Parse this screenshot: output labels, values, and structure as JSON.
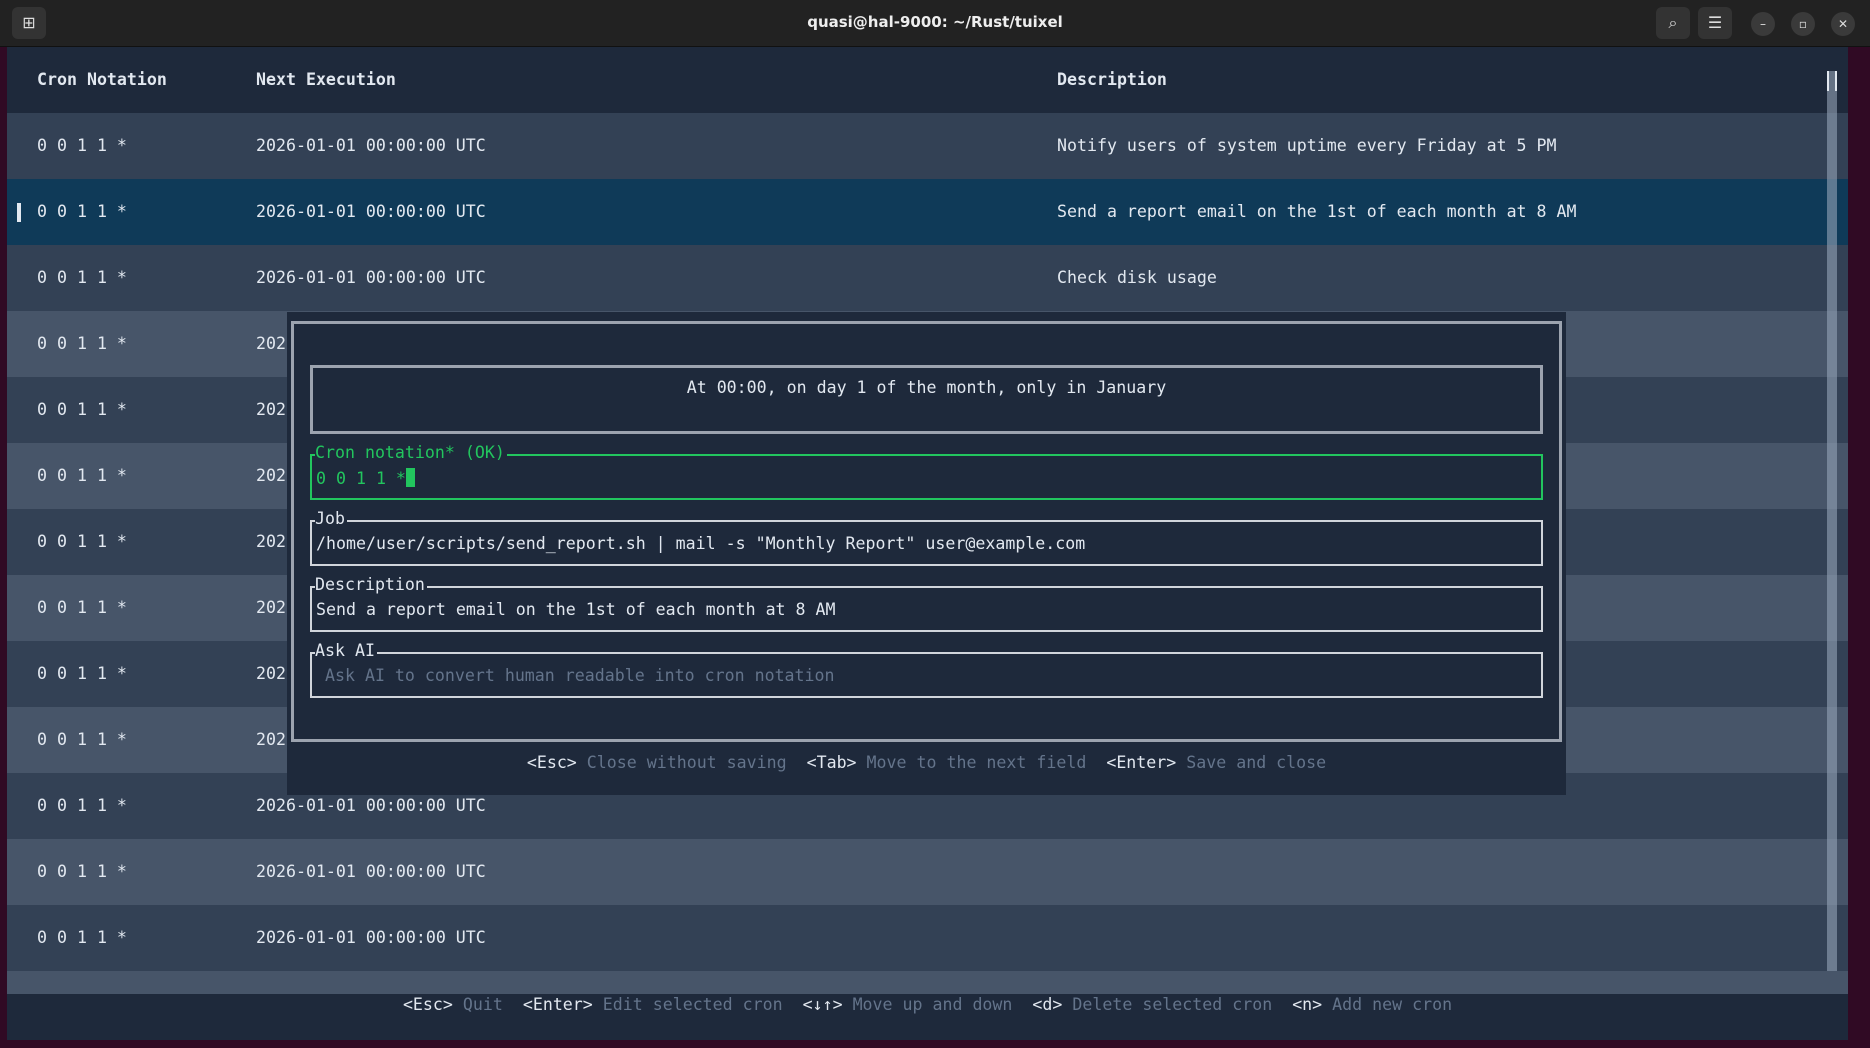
{
  "window": {
    "title": "quasi@hal-9000: ~/Rust/tuixel"
  },
  "table": {
    "headers": [
      "Cron Notation",
      "Next Execution",
      "Description"
    ],
    "rows": [
      {
        "cron": "0 0 1 1 *",
        "next": "2026-01-01 00:00:00 UTC",
        "desc": "Notify users of system uptime every Friday at 5 PM"
      },
      {
        "cron": "0 0 1 1 *",
        "next": "2026-01-01 00:00:00 UTC",
        "desc": "Send a report email on the 1st of each month at 8 AM",
        "selected": true
      },
      {
        "cron": "0 0 1 1 *",
        "next": "2026-01-01 00:00:00 UTC",
        "desc": "Check disk usage"
      },
      {
        "cron": "0 0 1 1 *",
        "next": "202",
        "desc": ""
      },
      {
        "cron": "0 0 1 1 *",
        "next": "202",
        "desc": ""
      },
      {
        "cron": "0 0 1 1 *",
        "next": "202",
        "desc": ""
      },
      {
        "cron": "0 0 1 1 *",
        "next": "202",
        "desc": ""
      },
      {
        "cron": "0 0 1 1 *",
        "next": "202",
        "desc": ""
      },
      {
        "cron": "0 0 1 1 *",
        "next": "202",
        "desc": ""
      },
      {
        "cron": "0 0 1 1 *",
        "next": "202",
        "desc": ""
      },
      {
        "cron": "0 0 1 1 *",
        "next": "2026-01-01 00:00:00 UTC",
        "desc": ""
      },
      {
        "cron": "0 0 1 1 *",
        "next": "2026-01-01 00:00:00 UTC",
        "desc": ""
      },
      {
        "cron": "0 0 1 1 *",
        "next": "2026-01-01 00:00:00 UTC",
        "desc": ""
      }
    ]
  },
  "popup": {
    "summary": "At 00:00, on day 1 of the month, only in January",
    "cron_label": "Cron notation* (OK)",
    "cron_value": "0 0 1 1 *",
    "job_label": "Job",
    "job_value": "/home/user/scripts/send_report.sh | mail -s \"Monthly Report\" user@example.com",
    "desc_label": "Description",
    "desc_value": "Send a report email on the 1st of each month at 8 AM",
    "ai_label": "Ask AI",
    "ai_placeholder": "Ask AI to convert human readable into cron notation",
    "help": [
      {
        "key": "<Esc>",
        "text": "Close without saving"
      },
      {
        "key": "<Tab>",
        "text": "Move to the next field"
      },
      {
        "key": "<Enter>",
        "text": "Save and close"
      }
    ]
  },
  "footer": {
    "help": [
      {
        "key": "<Esc>",
        "text": "Quit"
      },
      {
        "key": "<Enter>",
        "text": "Edit selected cron"
      },
      {
        "key": "<↓↑>",
        "text": "Move up and down"
      },
      {
        "key": "<d>",
        "text": "Delete selected cron"
      },
      {
        "key": "<n>",
        "text": "Add new cron"
      }
    ]
  },
  "colors": {
    "accent_ok": "#22c55e",
    "selected_row": "#0f3a58"
  }
}
